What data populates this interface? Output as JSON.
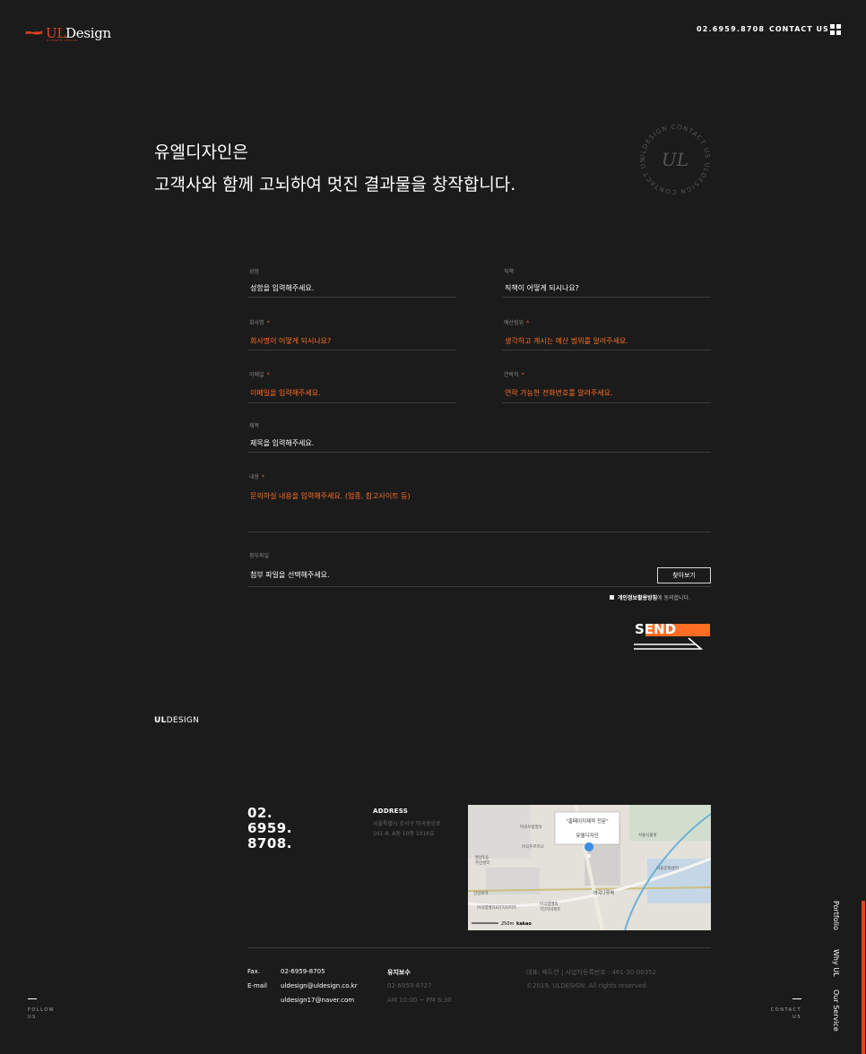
{
  "header": {
    "logo_prefix": "UL",
    "logo_suffix": "Design",
    "logo_sub": "ULTIMATE DESIGN",
    "phone": "02.6959.8708",
    "contact": "CONTACT US",
    "menu_icon": "grid-menu-icon"
  },
  "hero": {
    "line1": "유엘디자인은",
    "line2": "고객사와 함께 고뇌하여 멋진 결과물을 창작합니다.",
    "stamp_ring": "ULDESIGN CONTACT US ULDESIGN CONTACT US",
    "stamp_center": "UL"
  },
  "form": {
    "name": {
      "label": "성함",
      "value": "성함을 입력해주세요."
    },
    "position": {
      "label": "직책",
      "value": "직책이 어떻게 되시나요?"
    },
    "company": {
      "label": "회사명",
      "required": "*",
      "value": "회사명이 어떻게 되시나요?"
    },
    "budget": {
      "label": "예산범위",
      "required": "*",
      "value": "생각하고 계시는 예산 범위를 알려주세요."
    },
    "email": {
      "label": "이메일",
      "required": "*",
      "value": "이메일을 입력해주세요."
    },
    "phone": {
      "label": "연락처",
      "required": "*",
      "value": "연락 가능한 전화번호를 알려주세요."
    },
    "subject": {
      "label": "제목",
      "value": "제목을 입력해주세요."
    },
    "content": {
      "label": "내용",
      "required": "*",
      "value": "문의하실 내용을 입력해주세요. (업종, 참고사이트 등)"
    },
    "file": {
      "label": "첨부파일",
      "value": "첨부 파일을 선택해주세요.",
      "button": "찾아보기"
    },
    "privacy": {
      "link": "개인정보활용방침",
      "text": "에 동의합니다."
    },
    "send": "SEND"
  },
  "footer": {
    "brand_bold": "UL",
    "brand_rest": "DESIGN",
    "big_phone": [
      "02.",
      "6959.",
      "8708."
    ],
    "address_title": "ADDRESS",
    "address_line1": "서울특별시 강서구 마곡중앙로",
    "address_line2": "161-8, A동 10층 1016호",
    "map": {
      "callout_line1": "\"홈페이지제작 전문\"",
      "callout_line2": "유엘디자인",
      "scale": "250m",
      "brand": "kakao",
      "labels": [
        "마곡엠밸리14단지",
        "마곡우림필유",
        "마곡나루역",
        "마곡푸르지오",
        "신방화역",
        "발산1동",
        "주민센터",
        "식물문화센터",
        "마곡엠밸리",
        "7단지아파트",
        "마곡엠밸리6단지아파트",
        "서울식물원"
      ]
    },
    "fax_label": "Fax.",
    "fax": "02-6959-8705",
    "email_label": "E-mail",
    "email1": "uldesign@uldesign.co.kr",
    "email2": "uldesign17@naver.com",
    "maint_title": "유지보수",
    "maint_phone": "02-6959-8727",
    "maint_hours": "AM 10:00 ~ PM 6:30",
    "ceo": "대표: 배도연 | 사업자등록번호 : 461-30-00352",
    "copyright": "©2019, ULDESIGN. All rights reserved.",
    "follow_line1": "FOLLOW",
    "follow_line2": "US",
    "contact_line1": "CONTACT",
    "contact_line2": "US",
    "side_links": [
      "Portfolio",
      "Why UL",
      "Our Service"
    ]
  },
  "colors": {
    "background": "#1b1b1b",
    "accent": "#ff6d25",
    "logo_red": "#e0451c"
  }
}
